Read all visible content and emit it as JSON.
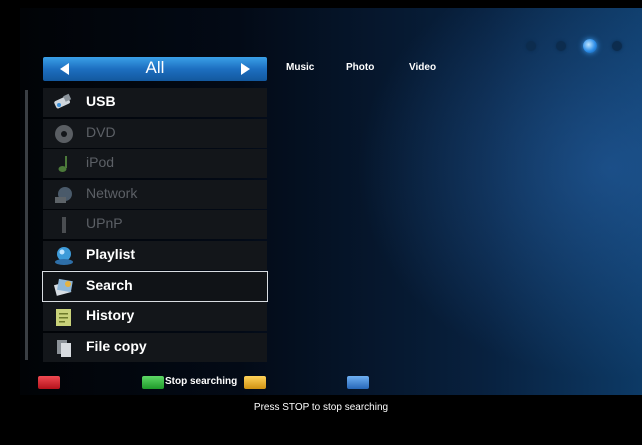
{
  "category_bar": {
    "label": "All"
  },
  "top_tabs": [
    {
      "label": "Music"
    },
    {
      "label": "Photo"
    },
    {
      "label": "Video"
    }
  ],
  "page_dots": {
    "count": 4,
    "active_index": 2
  },
  "sources": [
    {
      "label": "USB",
      "icon": "usb-drive-icon",
      "enabled": true
    },
    {
      "label": "DVD",
      "icon": "disc-icon",
      "enabled": false
    },
    {
      "label": "iPod",
      "icon": "music-note-icon",
      "enabled": false
    },
    {
      "label": "Network",
      "icon": "network-icon",
      "enabled": false
    },
    {
      "label": "UPnP",
      "icon": "upnp-icon",
      "enabled": false
    },
    {
      "label": "Playlist",
      "icon": "playlist-icon",
      "enabled": true
    },
    {
      "label": "Search",
      "icon": "search-icon",
      "enabled": true,
      "selected": true
    },
    {
      "label": "History",
      "icon": "history-icon",
      "enabled": true
    },
    {
      "label": "File copy",
      "icon": "file-copy-icon",
      "enabled": true
    }
  ],
  "color_keys": {
    "red": {
      "color": "#d0202a"
    },
    "green": {
      "color": "#2fb53a",
      "label": "Stop searching"
    },
    "yellow": {
      "color": "#e8b21f"
    },
    "blue": {
      "color": "#3d86d8"
    }
  },
  "footer": {
    "hint": "Press STOP to stop searching"
  }
}
